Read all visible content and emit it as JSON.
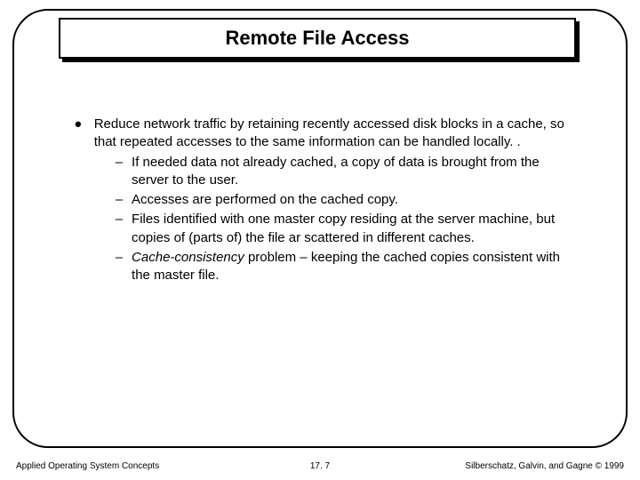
{
  "title": "Remote File Access",
  "main_bullet": "Reduce network traffic by retaining recently accessed disk blocks in a cache, so that repeated accesses to the same information can be handled locally. .",
  "sub_items": [
    {
      "prefix": "",
      "text": "If needed data not already cached, a copy of data is brought from the server to the user."
    },
    {
      "prefix": "",
      "text": "Accesses are performed on the cached copy."
    },
    {
      "prefix": "",
      "text": "Files identified with one master copy residing at the server machine, but copies of (parts of) the file ar scattered in different caches."
    },
    {
      "prefix": "Cache-consistency",
      "text": " problem – keeping the cached copies consistent with the master file."
    }
  ],
  "footer": {
    "left": "Applied Operating System Concepts",
    "center": "17. 7",
    "right": "Silberschatz, Galvin, and Gagne © 1999"
  }
}
